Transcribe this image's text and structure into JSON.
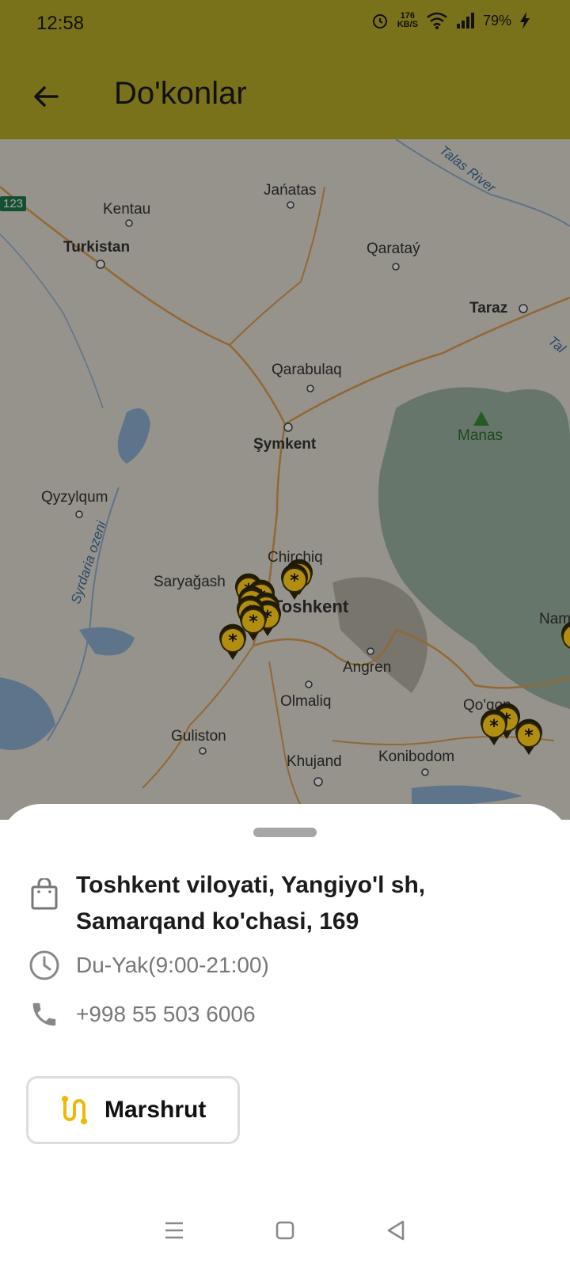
{
  "status": {
    "time": "12:58",
    "net_speed_value": "176",
    "net_speed_unit": "KB/S",
    "battery": "79%"
  },
  "app_bar": {
    "title": "Do'konlar"
  },
  "map": {
    "road_badge": "123",
    "labels": {
      "kentau": "Kentau",
      "janatas": "Jańatas",
      "turkistan": "Turkistan",
      "qaratay": "Qarataý",
      "taraz": "Taraz",
      "qarabulaq": "Qarabulaq",
      "manas": "Manas",
      "shymkent": "Şymkent",
      "qyzylqum": "Qyzylqum",
      "chirchiq": "Chirchiq",
      "saryagash": "Saryağash",
      "toshkent": "Toshkent",
      "angren": "Angren",
      "olmaliq": "Olmaliq",
      "nam": "Nam",
      "qoqon": "Qo'qon",
      "guliston": "Guliston",
      "khujand": "Khujand",
      "konibodom": "Konibodom",
      "talas_river": "Talas River",
      "tal": "Tal",
      "syrdaria": "Syrdaria ozeni"
    }
  },
  "store": {
    "address": "Toshkent viloyati, Yangiyo'l sh, Samarqand ko'chasi, 169",
    "hours": "Du-Yak(9:00-21:00)",
    "phone": "+998 55 503 6006",
    "route_label": "Marshrut"
  },
  "colors": {
    "app_bar": "#7a721b",
    "pin": "#d4a90a",
    "accent": "#f2b705"
  },
  "icons": {
    "back": "arrow-left-icon",
    "shop": "shopping-bag-icon",
    "clock": "clock-icon",
    "phone": "phone-icon",
    "route": "route-icon",
    "pin": "store-pin-icon"
  }
}
